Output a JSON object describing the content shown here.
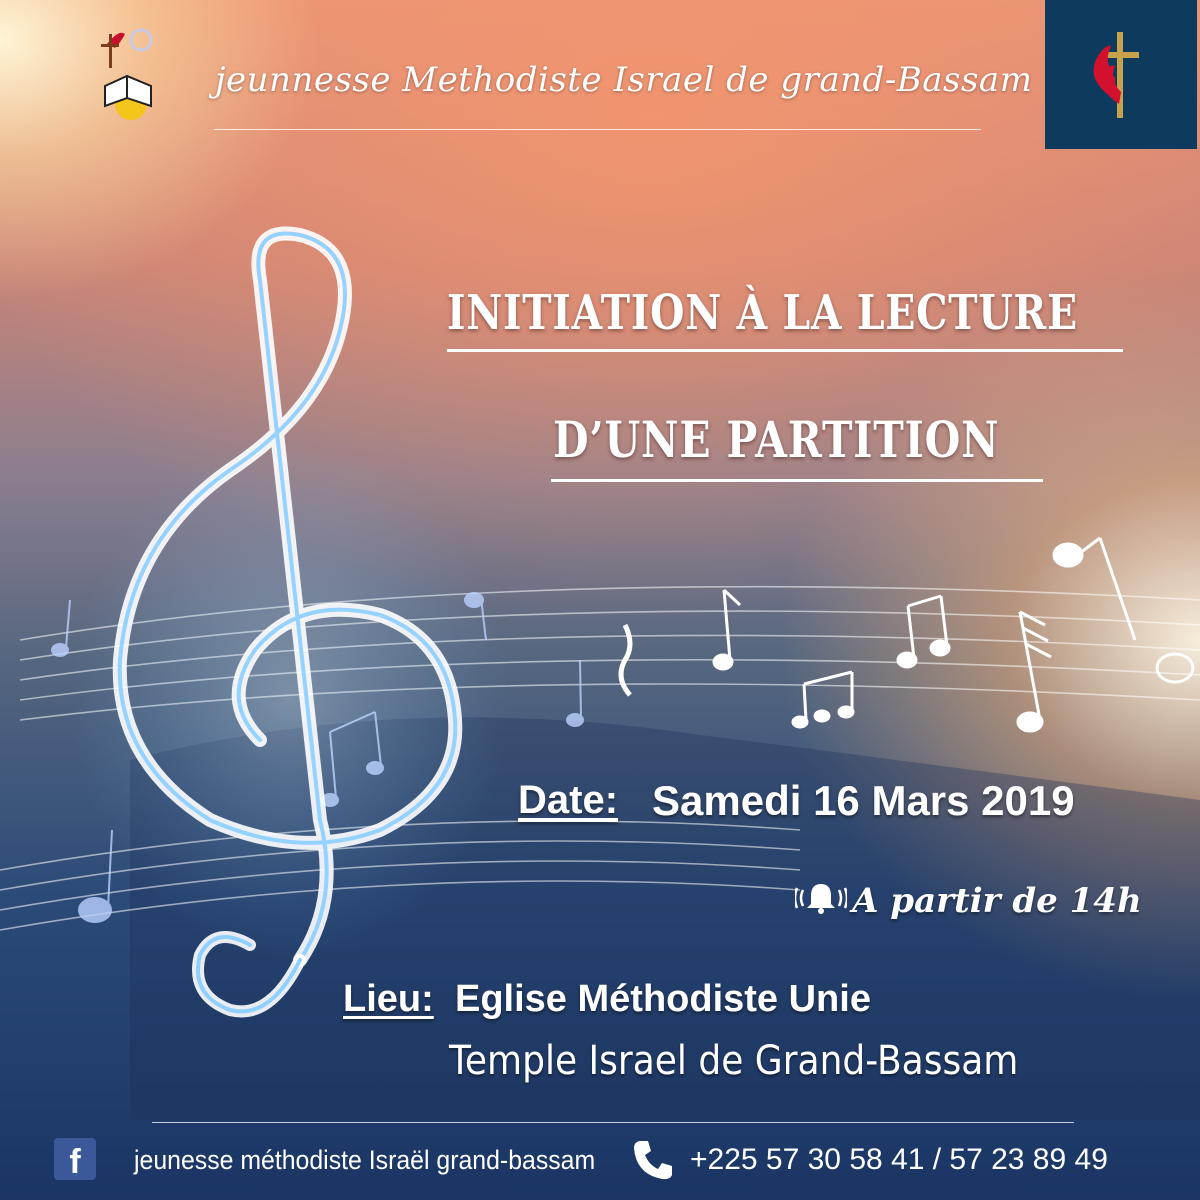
{
  "header": {
    "title": "jeunnesse Methodiste Israel de grand-Bassam"
  },
  "event": {
    "title_line_1": "INITIATION À LA LECTURE",
    "title_line_2": "D’UNE PARTITION",
    "date_label": "Date:",
    "date_value": "Samedi 16 Mars 2019",
    "time_text": "A partir de 14h",
    "venue_label": "Lieu:",
    "venue_line_1": "Eglise Méthodiste Unie",
    "venue_line_2": "Temple Israel de Grand-Bassam"
  },
  "footer": {
    "facebook_icon_letter": "f",
    "facebook_text": "jeunesse méthodiste Israël grand-bassam",
    "phone_text": "+225 57 30 58 41 / 57 23 89 49"
  },
  "icons": {
    "left_logo": "church-cross-bible-logo-icon",
    "right_logo": "methodist-cross-flame-icon",
    "treble_clef": "treble-clef-icon",
    "bell": "bell-icon",
    "facebook": "facebook-icon",
    "phone": "phone-icon"
  },
  "colors": {
    "right_logo_bg": "#0e3a5d",
    "facebook_blue": "#3b5998",
    "text": "#ffffff"
  }
}
